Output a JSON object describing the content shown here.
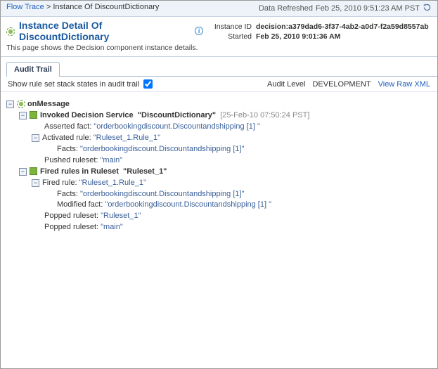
{
  "topbar": {
    "flow_trace": "Flow Trace",
    "sep": ">",
    "crumb": "Instance Of DiscountDictionary",
    "refreshed_label": "Data Refreshed",
    "refreshed_value": "Feb 25, 2010 9:51:23 AM PST"
  },
  "header": {
    "title": "Instance Detail Of DiscountDictionary",
    "subtitle": "This page shows the Decision component instance details.",
    "instance_id_label": "Instance ID",
    "instance_id_value": "decision:a379dad6-3f37-4ab2-a0d7-f2a59d8557ab",
    "started_label": "Started",
    "started_value": "Feb 25, 2010 9:01:36 AM"
  },
  "tabs": {
    "audit_trail": "Audit Trail"
  },
  "audit": {
    "show_rule_label": "Show rule set stack states in audit trail",
    "level_label": "Audit Level",
    "level_value": "DEVELOPMENT",
    "view_raw": "View Raw XML"
  },
  "tree": {
    "onmessage": "onMessage",
    "invoked": {
      "label": "Invoked Decision Service",
      "name": "\"DiscountDictionary\"",
      "timestamp": "[25-Feb-10 07:50:24 PST]",
      "asserted_label": "Asserted fact:",
      "asserted_value": "\"orderbookingdiscount.Discountandshipping [1] \"",
      "activated_label": "Activated rule:",
      "activated_value": "\"Ruleset_1.Rule_1\"",
      "facts_label": "Facts:",
      "facts_value": "\"orderbookingdiscount.Discountandshipping [1]\"",
      "pushed_label": "Pushed ruleset:",
      "pushed_value": "\"main\""
    },
    "fired": {
      "label": "Fired rules in Ruleset",
      "name": "\"Ruleset_1\"",
      "rule_label": "Fired rule:",
      "rule_value": "\"Ruleset_1.Rule_1\"",
      "facts_label": "Facts:",
      "facts_value": "\"orderbookingdiscount.Discountandshipping [1]\"",
      "modified_label": "Modified fact:",
      "modified_value": "\"orderbookingdiscount.Discountandshipping [1] \"",
      "popped1_label": "Popped ruleset:",
      "popped1_value": "\"Ruleset_1\"",
      "popped2_label": "Popped ruleset:",
      "popped2_value": "\"main\""
    }
  }
}
